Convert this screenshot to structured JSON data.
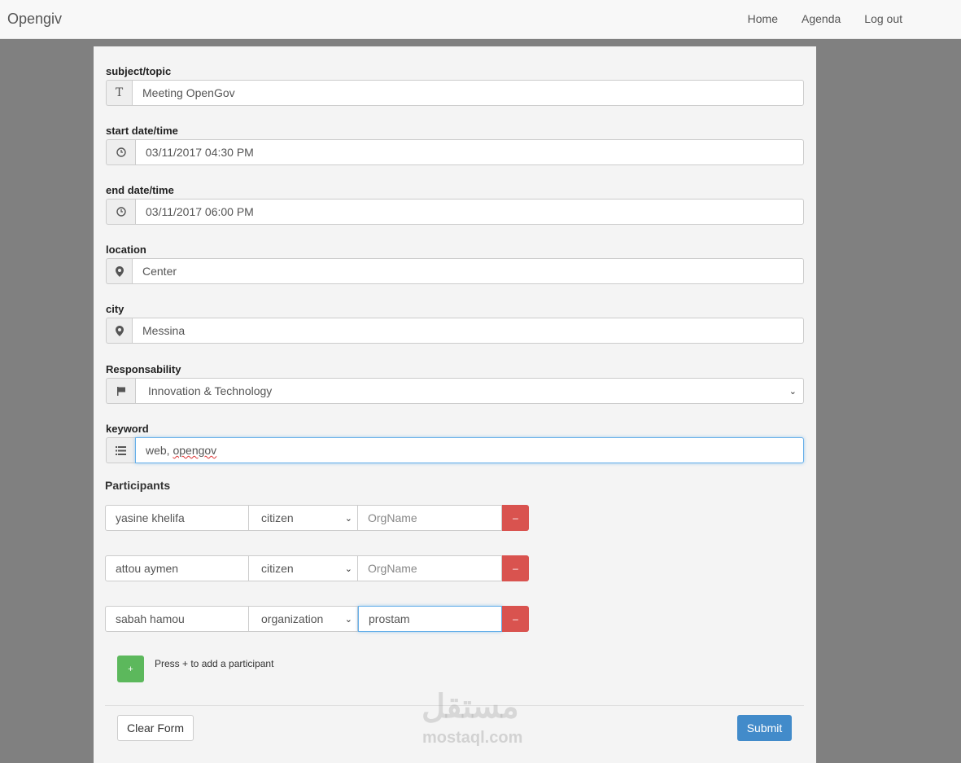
{
  "nav": {
    "brand": "Opengiv",
    "links": [
      "Home",
      "Agenda",
      "Log out"
    ]
  },
  "form": {
    "subject": {
      "label": "subject/topic",
      "icon": "text-icon",
      "value": "Meeting OpenGov"
    },
    "start": {
      "label": "start date/time",
      "icon": "clock-icon",
      "value": "03/11/2017 04:30 PM"
    },
    "end": {
      "label": "end date/time",
      "icon": "clock-icon",
      "value": "03/11/2017 06:00 PM"
    },
    "location": {
      "label": "location",
      "icon": "map-marker-icon",
      "value": "Center"
    },
    "city": {
      "label": "city",
      "icon": "map-marker-icon",
      "value": "Messina"
    },
    "responsability": {
      "label": "Responsability",
      "icon": "flag-icon",
      "value": "Innovation & Technology"
    },
    "keyword": {
      "label": "keyword",
      "icon": "list-icon",
      "value_a": "web, ",
      "value_b": "opengov"
    }
  },
  "participants": {
    "title": "Participants",
    "rows": [
      {
        "name": "yasine khelifa",
        "type": "citizen",
        "org": "OrgName"
      },
      {
        "name": "attou aymen",
        "type": "citizen",
        "org": "OrgName"
      },
      {
        "name": "sabah hamou",
        "type": "organization",
        "org": "prostam"
      }
    ],
    "remove_label": "–",
    "add_label": "+",
    "hint": "Press + to add a participant"
  },
  "actions": {
    "clear": "Clear Form",
    "submit": "Submit"
  },
  "watermark": {
    "arabic": "مستقل",
    "latin": "mostaql.com"
  },
  "colors": {
    "danger": "#d9534f",
    "success": "#5cb85c",
    "primary": "#428bca"
  }
}
